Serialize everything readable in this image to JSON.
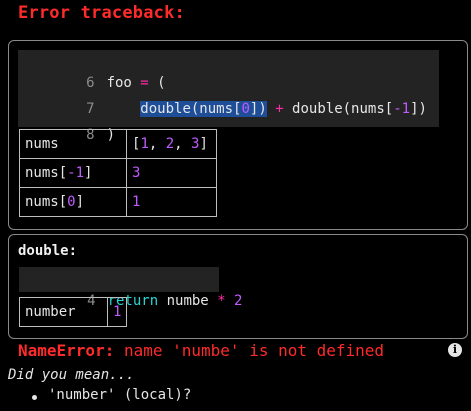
{
  "title": "Error traceback:",
  "frame1": {
    "code_lines": [
      {
        "num": "6",
        "text": "foo = ("
      },
      {
        "num": "7",
        "text": "    double(nums[0]) + double(nums[-1])"
      },
      {
        "num": "8",
        "text": ")"
      }
    ],
    "vars": [
      {
        "name": "nums",
        "value": "[1, 2, 3]"
      },
      {
        "name": "nums[-1]",
        "value": "3"
      },
      {
        "name": "nums[0]",
        "value": "1"
      }
    ]
  },
  "frame2": {
    "name": "double:",
    "code_line": {
      "num": "4",
      "text": "return numbe * 2"
    },
    "vars": [
      {
        "name": "number",
        "value": "1"
      }
    ]
  },
  "error": {
    "type": "NameError:",
    "message": " name 'numbe' is not defined",
    "info_icon": "info-icon"
  },
  "hint": {
    "did_you_mean": "Did you mean...",
    "suggestion": "'number' (local)?"
  },
  "colors": {
    "error": "#ff2b2b",
    "operator": "#ff2ba7",
    "number": "#c05cff",
    "keyword": "#2ad4d4",
    "highlight": "#1f4e99"
  }
}
